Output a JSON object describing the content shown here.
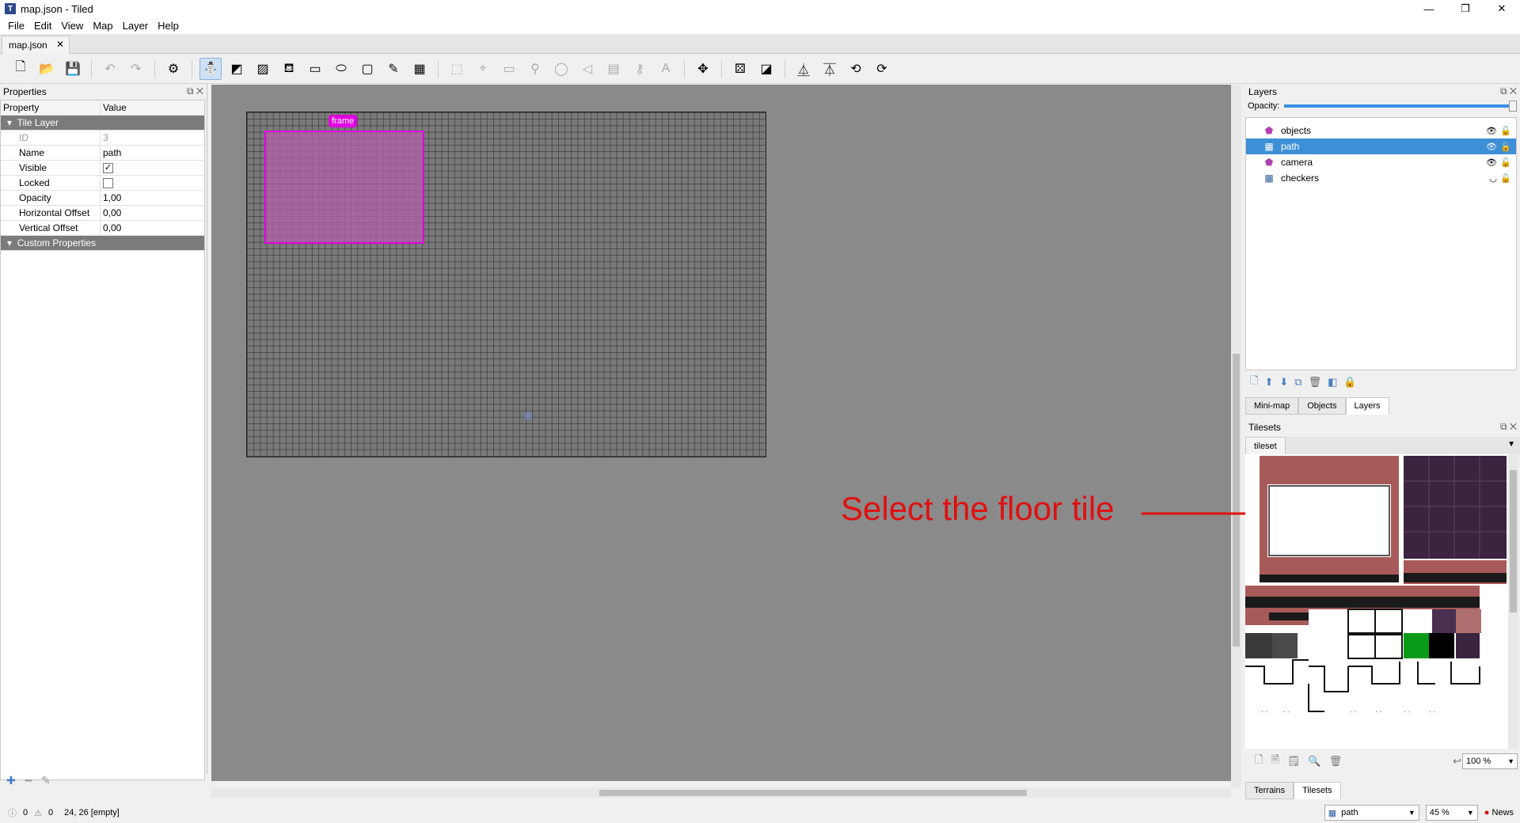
{
  "window": {
    "title": "map.json - Tiled",
    "min": "—",
    "restore": "❐",
    "close": "✕"
  },
  "menu": [
    "File",
    "Edit",
    "View",
    "Map",
    "Layer",
    "Help"
  ],
  "document_tab": {
    "label": "map.json",
    "close": "✕"
  },
  "properties": {
    "title": "Properties",
    "header": {
      "property": "Property",
      "value": "Value"
    },
    "group1": "Tile Layer",
    "rows": [
      {
        "key": "ID",
        "value": "3"
      },
      {
        "key": "Name",
        "value": "path"
      },
      {
        "key": "Visible",
        "value": "✓"
      },
      {
        "key": "Locked",
        "value": ""
      },
      {
        "key": "Opacity",
        "value": "1,00"
      },
      {
        "key": "Horizontal Offset",
        "value": "0,00"
      },
      {
        "key": "Vertical Offset",
        "value": "0,00"
      }
    ],
    "group2": "Custom Properties"
  },
  "map": {
    "object_label": "frame"
  },
  "annotation": "Select the floor tile",
  "layers": {
    "title": "Layers",
    "opacity_label": "Opacity:",
    "items": [
      {
        "name": "objects",
        "icon": "object-layer-icon"
      },
      {
        "name": "path",
        "icon": "tile-layer-icon",
        "selected": true
      },
      {
        "name": "camera",
        "icon": "object-layer-icon"
      },
      {
        "name": "checkers",
        "icon": "tile-layer-icon",
        "hidden": true
      }
    ],
    "tabs": [
      "Mini-map",
      "Objects",
      "Layers"
    ]
  },
  "tilesets": {
    "title": "Tilesets",
    "tab": "tileset",
    "zoom": "100 %",
    "tabs": [
      "Terrains",
      "Tilesets"
    ]
  },
  "status": {
    "errors": "0",
    "warnings": "0",
    "coords": "24, 26 [empty]",
    "layer": "path",
    "zoom": "45 %",
    "news": "News"
  }
}
